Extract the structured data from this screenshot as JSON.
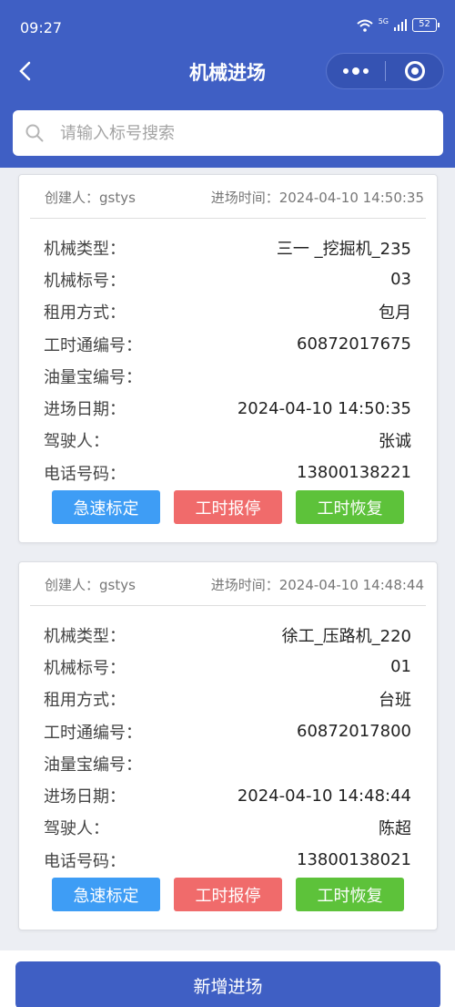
{
  "status_bar": {
    "time": "09:27",
    "signal_label": "5G",
    "battery": "52"
  },
  "nav": {
    "title": "机械进场"
  },
  "search": {
    "placeholder": "请输入标号搜索",
    "value": ""
  },
  "cards": [
    {
      "creator": "创建人：gstys",
      "entry_time": "进场时间：2024-04-10 14:50:35",
      "rows": [
        {
          "label": "机械类型：",
          "value": "三一 _挖掘机_235"
        },
        {
          "label": "机械标号：",
          "value": "03"
        },
        {
          "label": "租用方式：",
          "value": "包月"
        },
        {
          "label": "工时通编号：",
          "value": "60872017675"
        },
        {
          "label": "油量宝编号：",
          "value": ""
        },
        {
          "label": "进场日期：",
          "value": "2024-04-10 14:50:35"
        },
        {
          "label": "驾驶人：",
          "value": "张诚"
        },
        {
          "label": "电话号码：",
          "value": "13800138221"
        }
      ],
      "buttons": {
        "quick": "急速标定",
        "stop": "工时报停",
        "resume": "工时恢复"
      }
    },
    {
      "creator": "创建人：gstys",
      "entry_time": "进场时间：2024-04-10 14:48:44",
      "rows": [
        {
          "label": "机械类型：",
          "value": "徐工_压路机_220"
        },
        {
          "label": "机械标号：",
          "value": "01"
        },
        {
          "label": "租用方式：",
          "value": "台班"
        },
        {
          "label": "工时通编号：",
          "value": "60872017800"
        },
        {
          "label": "油量宝编号：",
          "value": ""
        },
        {
          "label": "进场日期：",
          "value": "2024-04-10 14:48:44"
        },
        {
          "label": "驾驶人：",
          "value": "陈超"
        },
        {
          "label": "电话号码：",
          "value": "13800138021"
        }
      ],
      "buttons": {
        "quick": "急速标定",
        "stop": "工时报停",
        "resume": "工时恢复"
      }
    }
  ],
  "footer": {
    "add_label": "新增进场"
  },
  "colors": {
    "primary": "#3f5fc4",
    "blue": "#3e9df5",
    "red": "#f06b6b",
    "green": "#5dc23a"
  },
  "icons": [
    "back-icon",
    "more-icon",
    "close-icon",
    "search-icon",
    "wifi-icon",
    "signal-icon",
    "battery-icon"
  ]
}
